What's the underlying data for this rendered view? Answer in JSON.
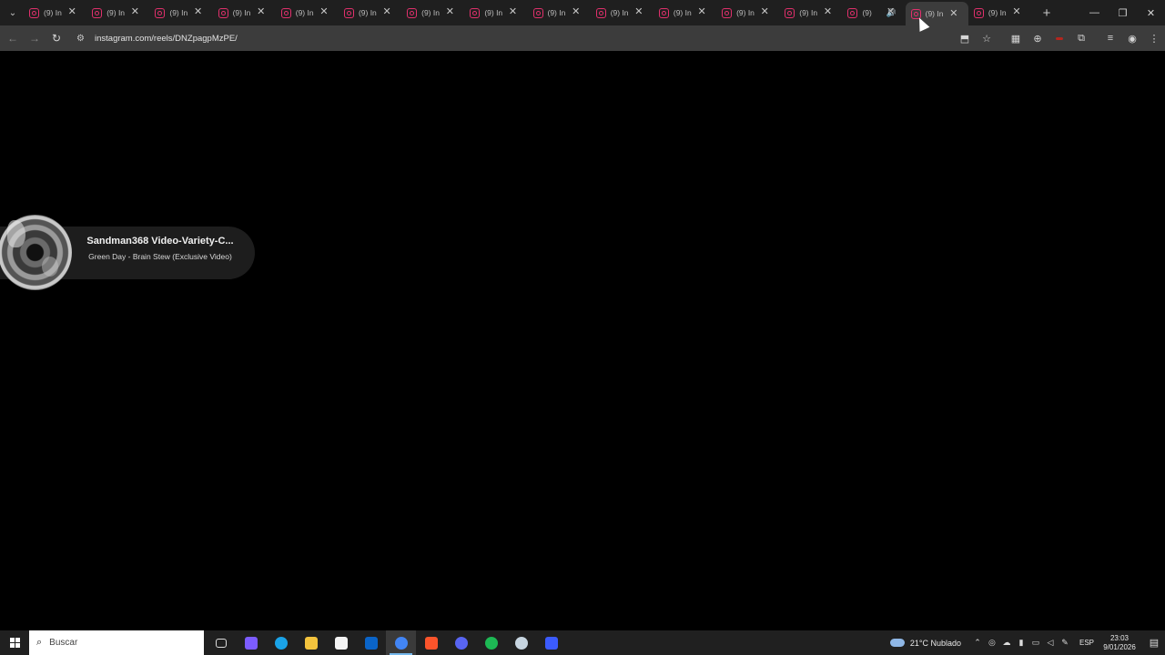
{
  "browser": {
    "tabs": [
      {
        "title": "(9) In",
        "active": false,
        "audio": false
      },
      {
        "title": "(9) In",
        "active": false,
        "audio": false
      },
      {
        "title": "(9) In",
        "active": false,
        "audio": false
      },
      {
        "title": "(9) In",
        "active": false,
        "audio": false
      },
      {
        "title": "(9) In",
        "active": false,
        "audio": false
      },
      {
        "title": "(9) In",
        "active": false,
        "audio": false
      },
      {
        "title": "(9) In",
        "active": false,
        "audio": false
      },
      {
        "title": "(9) In",
        "active": false,
        "audio": false
      },
      {
        "title": "(9) In",
        "active": false,
        "audio": false
      },
      {
        "title": "(9) In",
        "active": false,
        "audio": false
      },
      {
        "title": "(9) In",
        "active": false,
        "audio": false
      },
      {
        "title": "(9) In",
        "active": false,
        "audio": false
      },
      {
        "title": "(9) In",
        "active": false,
        "audio": false
      },
      {
        "title": "(9)",
        "active": false,
        "audio": true
      },
      {
        "title": "(9) In",
        "active": true,
        "audio": false
      },
      {
        "title": "(9) In",
        "active": false,
        "audio": false
      }
    ],
    "new_tab_glyph": "+",
    "window_controls": {
      "minimize": "—",
      "restore": "❐",
      "close": "✕"
    },
    "address": {
      "url": "instagram.com/reels/DNZpagpMzPE/"
    },
    "nav": {
      "back": "←",
      "forward": "→",
      "reload": "↻"
    }
  },
  "pip_player": {
    "channel": "Sandman368 Video-Variety-C...",
    "track": "Green Day - Brain Stew (Exclusive Video)"
  },
  "taskbar": {
    "search_placeholder": "Buscar",
    "apps": [
      {
        "name": "task-view",
        "color": "#2b2b2b",
        "active": false
      },
      {
        "name": "copilot",
        "color": "#7c5cff",
        "active": false
      },
      {
        "name": "edge",
        "color": "#1aa3e8",
        "active": false
      },
      {
        "name": "file-explorer",
        "color": "#f3c33d",
        "active": false
      },
      {
        "name": "microsoft-store",
        "color": "#f4f4f4",
        "active": false
      },
      {
        "name": "outlook",
        "color": "#0a64c8",
        "active": false
      },
      {
        "name": "chrome",
        "color": "#4285f4",
        "active": true
      },
      {
        "name": "brave",
        "color": "#fb542b",
        "active": false
      },
      {
        "name": "discord",
        "color": "#5865f2",
        "active": false
      },
      {
        "name": "spotify",
        "color": "#1db954",
        "active": false
      },
      {
        "name": "steam",
        "color": "#c7d5e0",
        "active": false
      },
      {
        "name": "notes-app",
        "color": "#3b5bfd",
        "active": false
      }
    ],
    "weather": {
      "temp": "21°C",
      "condition": "Nublado"
    },
    "language": "ESP",
    "time": "23:03",
    "date": "9/01/2026"
  }
}
